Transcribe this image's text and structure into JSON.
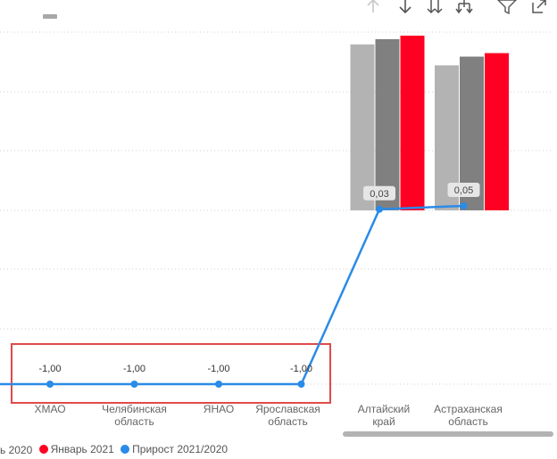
{
  "toolbar": {
    "icons": [
      "drill-up-icon",
      "drill-down-icon",
      "expand-level-icon",
      "expand-hierarchy-icon",
      "filter-icon",
      "focus-mode-icon"
    ]
  },
  "colors": {
    "series_2019": "#b3b3b3",
    "series_2020": "#808080",
    "series_2021": "#ff0022",
    "growth_line": "#2a8be8",
    "highlight_box": "#e04a4a",
    "gridline": "#d0d0d0",
    "data_label_bg": "#e6e6e6"
  },
  "legend": {
    "items": [
      {
        "label": "ь 2020",
        "color": "#808080"
      },
      {
        "label": "Январь 2021",
        "color": "#ff0022"
      },
      {
        "label": "Прирост 2021/2020",
        "color": "#2a8be8"
      }
    ]
  },
  "chart_data": {
    "type": "bar",
    "combo": "bar-line",
    "categories": [
      "ХМАО",
      "Челябинская область",
      "ЯНАО",
      "Ярославская область",
      "Алтайский край",
      "Астраханская область"
    ],
    "series": [
      {
        "type": "bar",
        "values": [
          0,
          0,
          0,
          0,
          95,
          83
        ],
        "color": "#b3b3b3"
      },
      {
        "name": "ь 2020",
        "type": "bar",
        "values": [
          0,
          0,
          0,
          0,
          98,
          88
        ],
        "color": "#808080"
      },
      {
        "name": "Январь 2021",
        "type": "bar",
        "values": [
          0,
          0,
          0,
          0,
          100,
          90
        ],
        "color": "#ff0022"
      },
      {
        "name": "Прирост 2021/2020",
        "type": "line",
        "values": [
          -1.0,
          -1.0,
          -1.0,
          -1.0,
          0.03,
          0.05
        ],
        "color": "#2a8be8",
        "axis": "secondary"
      }
    ],
    "data_labels": [
      "-1,00",
      "-1,00",
      "-1,00",
      "-1,00",
      "0,03",
      "0,05"
    ],
    "line_axis_range": [
      -1.0,
      0.05
    ],
    "grid": true,
    "legend_position": "bottom-left",
    "highlight": {
      "categories": [
        "ХМАО",
        "Челябинская область",
        "ЯНАО",
        "Ярославская область"
      ]
    }
  }
}
